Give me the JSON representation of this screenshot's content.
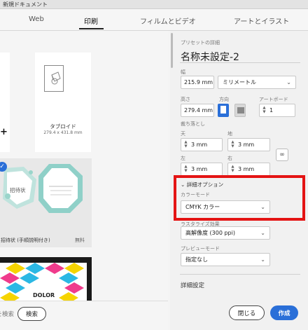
{
  "window": {
    "title": "新規ドキュメント"
  },
  "tabs": [
    {
      "label": "Web"
    },
    {
      "label": "印刷"
    },
    {
      "label": "フィルムとビデオ"
    },
    {
      "label": "アートとイラスト"
    }
  ],
  "presets": {
    "tabloid_name": "タブロイド",
    "tabloid_size": "279.4 x 431.8 mm",
    "add_symbol": "+"
  },
  "templates": [
    {
      "label": "招待状 (手順説明付き)",
      "price": "無料",
      "card_text": "招待状"
    },
    {
      "label": "",
      "price": "",
      "card_text": "DOLOR"
    }
  ],
  "search": {
    "placeholder": "を検索",
    "button_label": "検索"
  },
  "details": {
    "section_title": "プリセットの詳細",
    "preset_name": "名称未設定-2",
    "width_label": "幅",
    "width_value": "215.9 mm",
    "unit": "ミリメートル",
    "height_label": "高さ",
    "height_value": "279.4 mm",
    "orientation_label": "方向",
    "artboards_label": "アートボード",
    "artboards_value": "1",
    "bleed_label": "裁ち落とし",
    "bleed": {
      "top_label": "天",
      "top": "3 mm",
      "bottom_label": "地",
      "bottom": "3 mm",
      "left_label": "左",
      "left": "3 mm",
      "right_label": "右",
      "right": "3 mm"
    },
    "advanced_options": "詳細オプション",
    "color_mode_label": "カラーモード",
    "color_mode": "CMYK カラー",
    "raster_label": "ラスタライズ効果",
    "raster": "高解像度 (300 ppi)",
    "preview_label": "プレビューモード",
    "preview": "指定なし",
    "advanced_settings": "詳細設定"
  },
  "actions": {
    "close": "閉じる",
    "create": "作成"
  },
  "colors": {
    "accent": "#2a6fd8",
    "highlight": "#e41414"
  }
}
